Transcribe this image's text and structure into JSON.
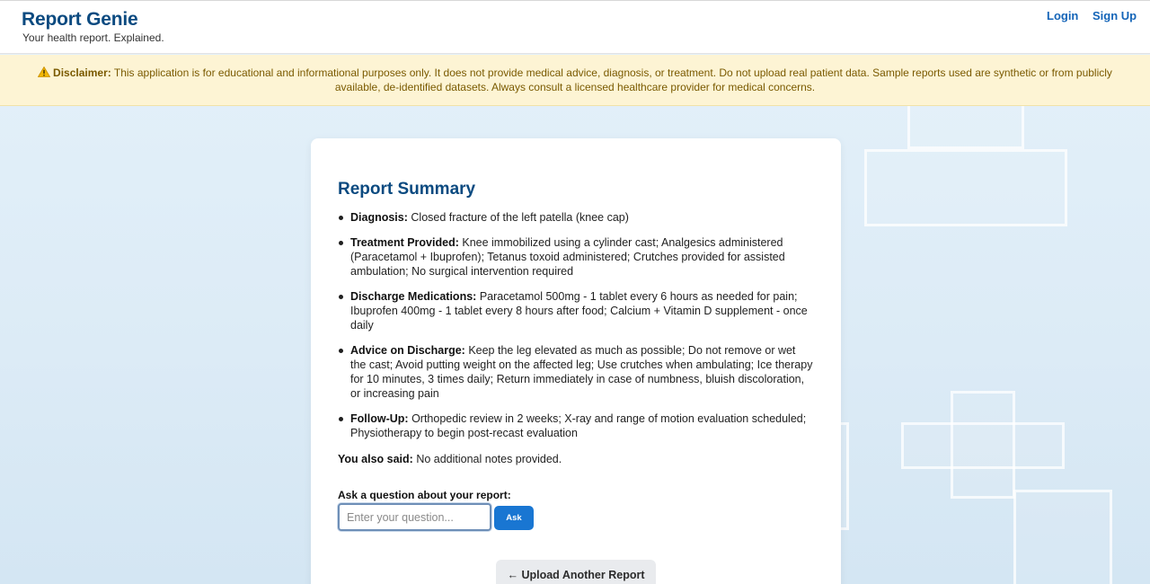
{
  "app": {
    "title": "Report Genie",
    "tagline": "Your health report. Explained."
  },
  "nav": {
    "login": "Login",
    "signup": "Sign Up"
  },
  "disclaimer": {
    "icon": "warning-icon",
    "label": "Disclaimer:",
    "text": "This application is for educational and informational purposes only. It does not provide medical advice, diagnosis, or treatment. Do not upload real patient data. Sample reports used are synthetic or from publicly available, de-identified datasets. Always consult a licensed healthcare provider for medical concerns."
  },
  "summary": {
    "title": "Report Summary",
    "items": [
      {
        "label": "Diagnosis:",
        "text": "Closed fracture of the left patella (knee cap)"
      },
      {
        "label": "Treatment Provided:",
        "text": "Knee immobilized using a cylinder cast; Analgesics administered (Paracetamol + Ibuprofen); Tetanus toxoid administered; Crutches provided for assisted ambulation; No surgical intervention required"
      },
      {
        "label": "Discharge Medications:",
        "text": "Paracetamol 500mg - 1 tablet every 6 hours as needed for pain; Ibuprofen 400mg - 1 tablet every 8 hours after food; Calcium + Vitamin D supplement - once daily"
      },
      {
        "label": "Advice on Discharge:",
        "text": "Keep the leg elevated as much as possible; Do not remove or wet the cast; Avoid putting weight on the affected leg; Use crutches when ambulating; Ice therapy for 10 minutes, 3 times daily; Return immediately in case of numbness, bluish discoloration, or increasing pain"
      },
      {
        "label": "Follow-Up:",
        "text": "Orthopedic review in 2 weeks; X-ray and range of motion evaluation scheduled; Physiotherapy to begin post-recast evaluation"
      }
    ],
    "notes_label": "You also said:",
    "notes_text": "No additional notes provided."
  },
  "question": {
    "label": "Ask a question about your report:",
    "placeholder": "Enter your question...",
    "value": "",
    "button": "Ask"
  },
  "upload": {
    "button": "← Upload Another Report"
  },
  "colors": {
    "brand": "#0b4a80",
    "link": "#1565b8",
    "button": "#1976d2",
    "disclaimer_bg": "#fdf4d4",
    "disclaimer_text": "#7a5a00"
  }
}
